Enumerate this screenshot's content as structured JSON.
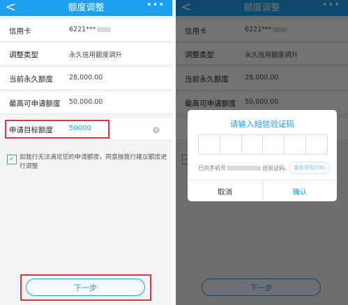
{
  "nav": {
    "back": "<",
    "title": "额度调整",
    "more": "•••"
  },
  "rows": [
    {
      "label": "信用卡",
      "value": "6221***"
    },
    {
      "label": "调整类型",
      "value": "永久信用额度调升"
    },
    {
      "label": "当前永久额度",
      "value": "28,000.00"
    },
    {
      "label": "最高可申请额度",
      "value": "50,000.00"
    }
  ],
  "target": {
    "label": "申请目标额度",
    "value": "50000",
    "clear": "×"
  },
  "agreement": {
    "check": "✓",
    "text": "如我行无法满足您的申请额度，同意按我行建议额度进行调整"
  },
  "next_button": "下一步",
  "dialog": {
    "title": "请输入短信验证码",
    "sent_prefix": "已向手机号",
    "sent_suffix": "送验证码。",
    "resend": "重新获取(56)",
    "cancel": "取消",
    "confirm": "确认"
  },
  "colors": {
    "brand_blue": "#1d9ff2",
    "highlight_red": "#d6383e",
    "check_green": "#3cab5b"
  }
}
